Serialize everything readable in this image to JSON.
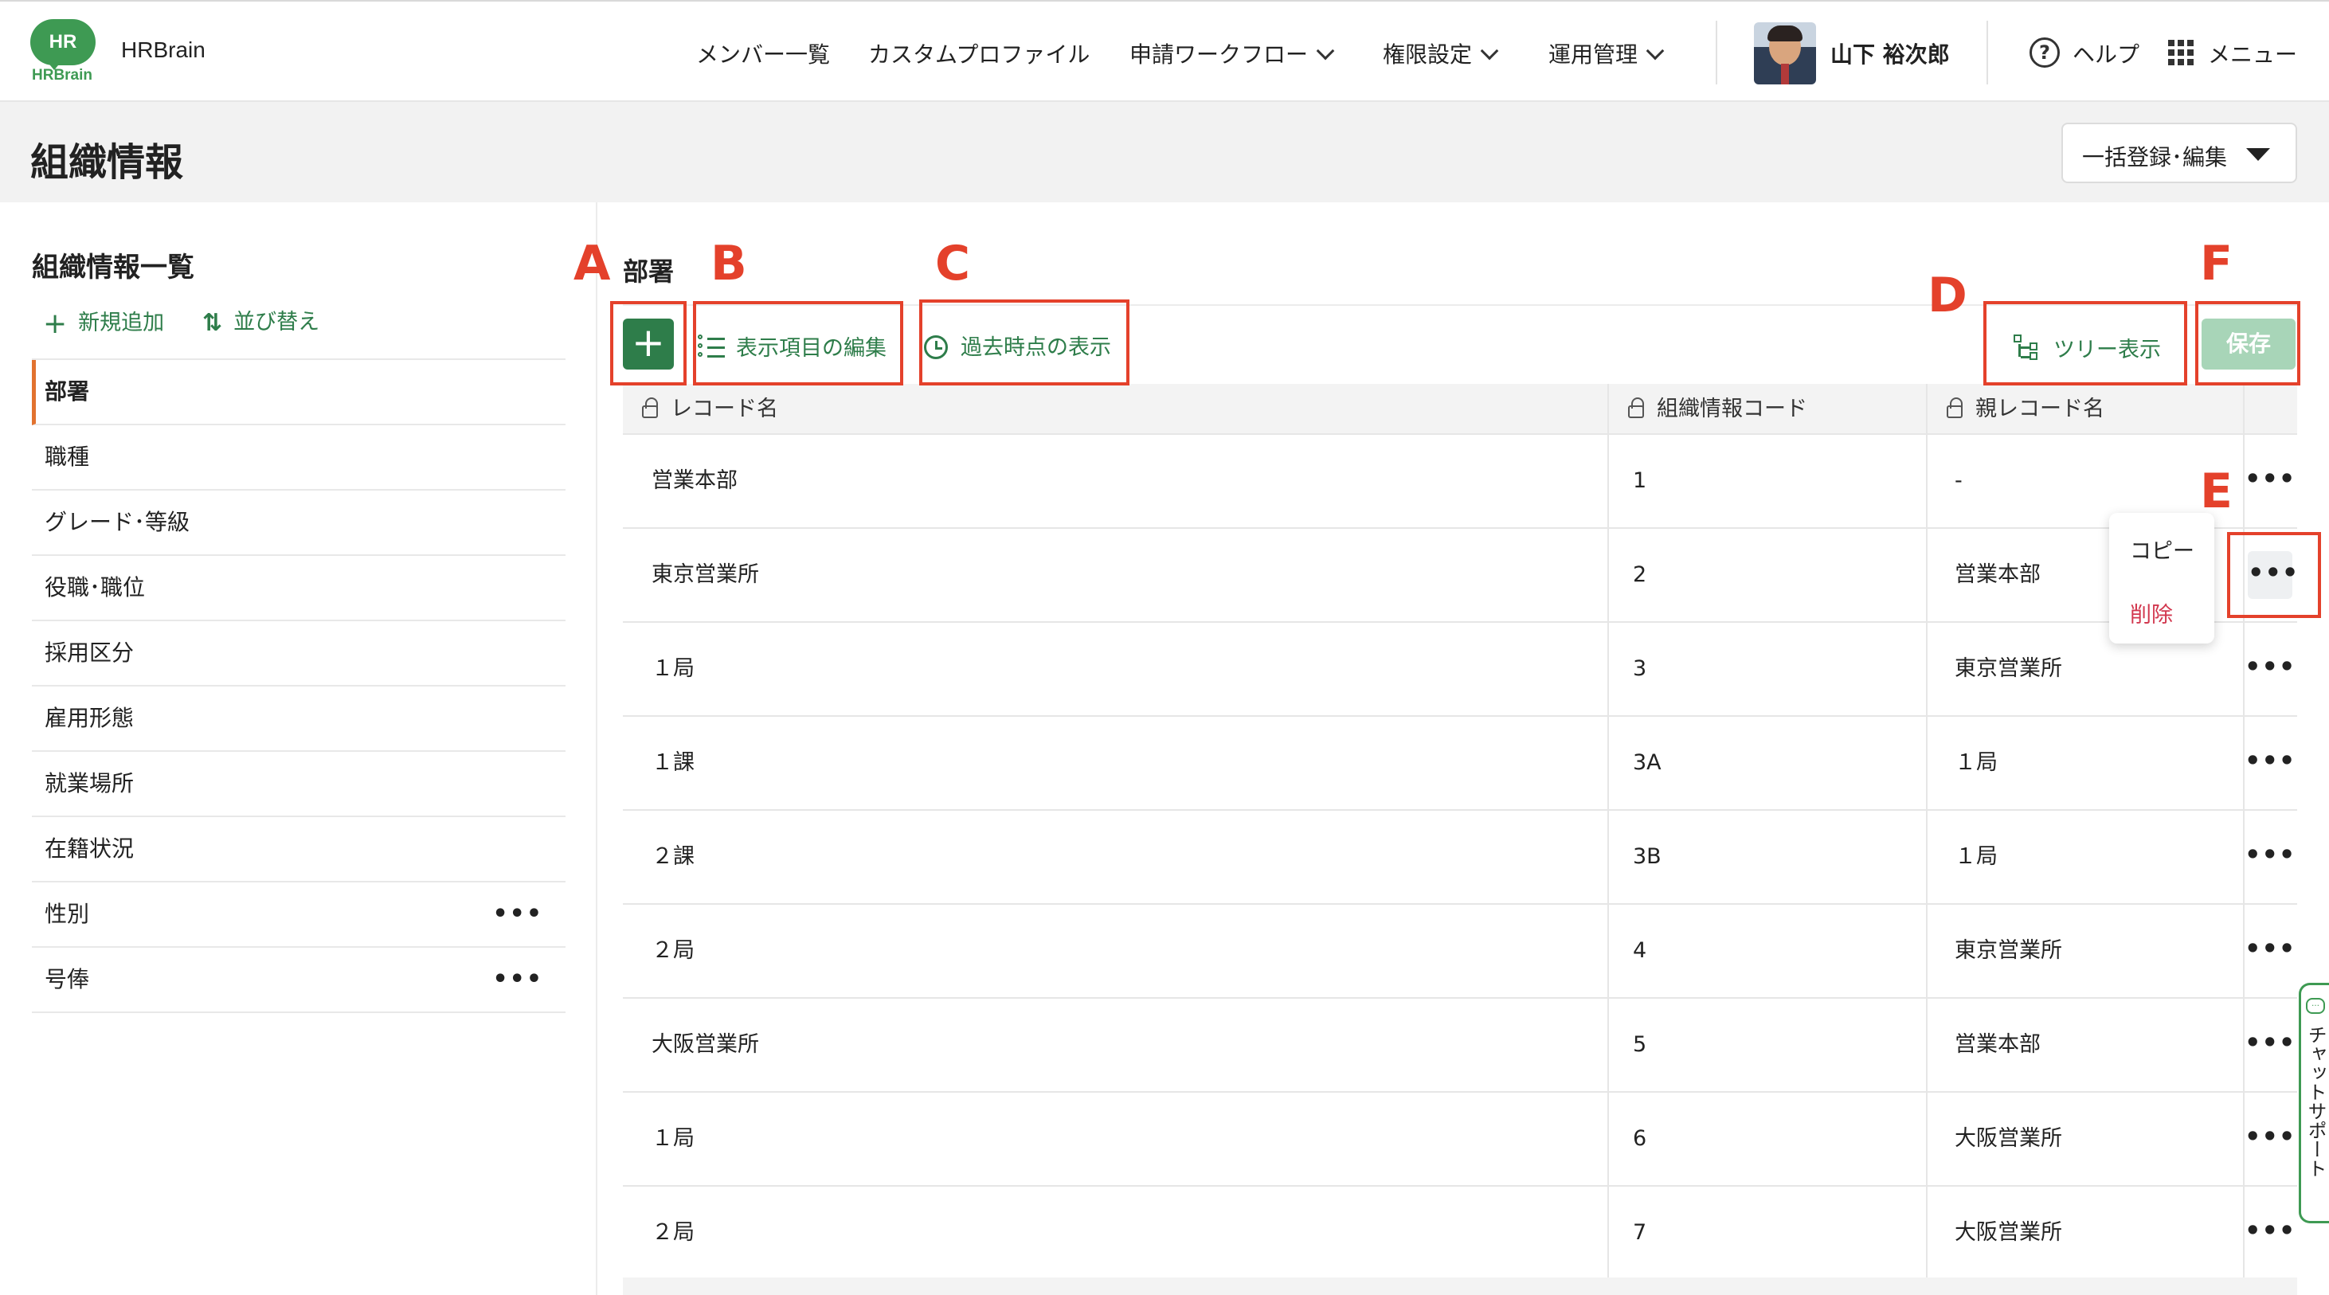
{
  "header": {
    "logo_mark": "HR",
    "logo_word": "HRBrain",
    "brand": "HRBrain",
    "nav": [
      {
        "label": "メンバー一覧"
      },
      {
        "label": "カスタムプロファイル"
      },
      {
        "label": "申請ワークフロー"
      },
      {
        "label": "権限設定"
      },
      {
        "label": "運用管理"
      }
    ],
    "user_name": "山下 裕次郎",
    "help_label": "ヘルプ",
    "menu_label": "メニュー"
  },
  "page": {
    "title": "組織情報",
    "bulk_button": "一括登録･編集"
  },
  "sidebar": {
    "title": "組織情報一覧",
    "add_label": "新規追加",
    "sort_label": "並び替え",
    "items": [
      {
        "label": "部署",
        "active": true
      },
      {
        "label": "職種"
      },
      {
        "label": "グレード･等級"
      },
      {
        "label": "役職･職位"
      },
      {
        "label": "採用区分"
      },
      {
        "label": "雇用形態"
      },
      {
        "label": "就業場所"
      },
      {
        "label": "在籍状況"
      },
      {
        "label": "性別",
        "menu": "•••"
      },
      {
        "label": "号俸",
        "menu": "•••"
      }
    ]
  },
  "main": {
    "section": "部署",
    "add_button": "+",
    "edit_columns_label": "表示項目の編集",
    "history_label": "過去時点の表示",
    "tree_label": "ツリー表示",
    "save_label": "保存",
    "columns": [
      "レコード名",
      "組織情報コード",
      "親レコード名"
    ],
    "rows": [
      {
        "name": "営業本部",
        "code": "1",
        "parent": "-"
      },
      {
        "name": "東京営業所",
        "code": "2",
        "parent": "営業本部"
      },
      {
        "name": "１局",
        "code": "3",
        "parent": "東京営業所"
      },
      {
        "name": "１課",
        "code": "3A",
        "parent": "１局"
      },
      {
        "name": "２課",
        "code": "3B",
        "parent": "１局"
      },
      {
        "name": "２局",
        "code": "4",
        "parent": "東京営業所"
      },
      {
        "name": "大阪営業所",
        "code": "5",
        "parent": "営業本部"
      },
      {
        "name": "１局",
        "code": "6",
        "parent": "大阪営業所"
      },
      {
        "name": "２局",
        "code": "7",
        "parent": "大阪営業所"
      }
    ],
    "row_menu": "•••",
    "popover": {
      "copy": "コピー",
      "delete": "削除"
    }
  },
  "callouts": [
    "A",
    "B",
    "C",
    "D",
    "E",
    "F"
  ],
  "chat_support": "チャットサポート",
  "colors": {
    "brand_green": "#3e9a53",
    "action_green": "#2e7d4a",
    "save_disabled": "#a8d5b8",
    "callout_red": "#e4412b",
    "active_accent": "#e2722f",
    "delete_red": "#d2374e"
  }
}
